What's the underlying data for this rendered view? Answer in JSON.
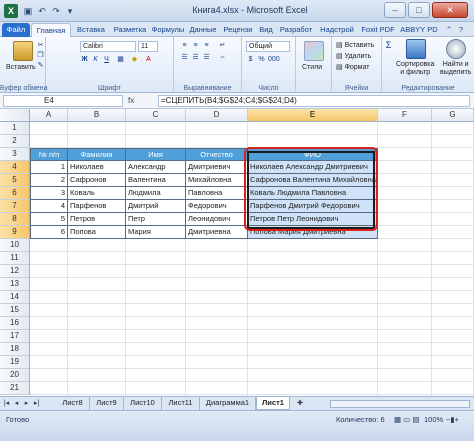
{
  "window": {
    "title": "Книга4.xlsx - Microsoft Excel",
    "app_icon": "X",
    "minimize_icon": "–",
    "maximize_icon": "□",
    "close_icon": "✕"
  },
  "ribbon_tabs": [
    "Файл",
    "Главная",
    "Вставка",
    "Разметка",
    "Формулы",
    "Данные",
    "Рецензи",
    "Вид",
    "Разработ",
    "Надстрой",
    "Foxit PDF",
    "ABBYY PD"
  ],
  "ribbon": {
    "paste_label": "Вставить",
    "clipboard_group": "Буфер обмена",
    "font_name": "Calibri",
    "font_size": "11",
    "font_group": "Шрифт",
    "align_group": "Выравнивание",
    "number_format": "Общий",
    "number_group": "Число",
    "styles_label": "Стили",
    "insert_label": "Вставить",
    "delete_label": "Удалить",
    "format_label": "Формат",
    "cells_group": "Ячейки",
    "sort_label": "Сортировка\nи фильтр",
    "find_label": "Найти и\nвыделить",
    "edit_group": "Редактирование",
    "sigma": "Σ"
  },
  "formula_bar": {
    "name_box": "E4",
    "fx": "fx",
    "formula": "=СЦЕПИТЬ(B4;$G$24;C4;$G$24;D4)"
  },
  "columns": [
    "A",
    "B",
    "C",
    "D",
    "E",
    "F",
    "G"
  ],
  "rows": [
    "1",
    "2",
    "3",
    "4",
    "5",
    "6",
    "7",
    "8",
    "9",
    "10",
    "11",
    "12",
    "13",
    "14",
    "15",
    "16",
    "17",
    "18",
    "19",
    "20",
    "21"
  ],
  "table": {
    "headers": [
      "№ п/п",
      "Фамилия",
      "Имя",
      "Отчество",
      "ФИО"
    ],
    "rows": [
      [
        "1",
        "Николаев",
        "Александр",
        "Дмитриевич",
        "Николаев Александр Дмитриевич"
      ],
      [
        "2",
        "Сафронов",
        "Валентина",
        "Михайловна",
        "Сафронова Валентина Михайловна"
      ],
      [
        "3",
        "Коваль",
        "Людмила",
        "Павловна",
        "Коваль Людмила Павловна"
      ],
      [
        "4",
        "Парфенов",
        "Дмитрий",
        "Федорович",
        "Парфенов Дмитрий Федорович"
      ],
      [
        "5",
        "Петров",
        "Петр",
        "Леонидович",
        "Петров Петр Леонидович"
      ],
      [
        "6",
        "Попова",
        "Мария",
        "Дмитриевна",
        "Попова Мария Дмитриевна"
      ]
    ]
  },
  "sheet_tabs": [
    "Лист8",
    "Лист9",
    "Лист10",
    "Лист11",
    "Диаграмма1",
    "Лист1"
  ],
  "active_sheet": "Лист1",
  "status": {
    "ready": "Готово",
    "count": "Количество: 6",
    "zoom": "100%"
  },
  "colors": {
    "header_fill": "#4f9fd9",
    "fio_fill": "#cfe2f7",
    "highlight_border": "#d8231d"
  }
}
